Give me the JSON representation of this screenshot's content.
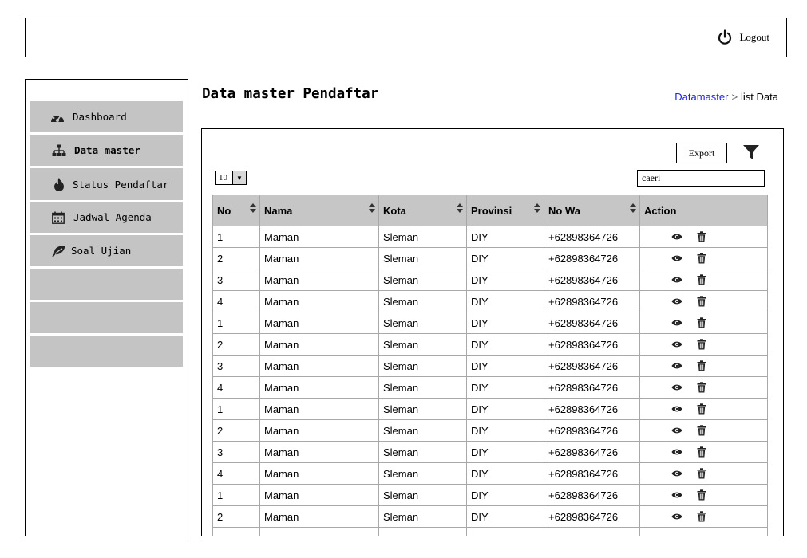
{
  "topbar": {
    "logout_label": "Logout",
    "logout_icon": "power-icon"
  },
  "sidebar": {
    "items": [
      {
        "label": "Dashboard",
        "icon": "dashboard-icon",
        "active": false
      },
      {
        "label": "Data master",
        "icon": "sitemap-icon",
        "active": true
      },
      {
        "label": "Status Pendaftar",
        "icon": "fire-icon",
        "active": false
      },
      {
        "label": "Jadwal Agenda",
        "icon": "calendar-icon",
        "active": false
      },
      {
        "label": "Soal Ujian",
        "icon": "leaf-icon",
        "active": false
      },
      {
        "label": "",
        "icon": "",
        "active": false
      },
      {
        "label": "",
        "icon": "",
        "active": false
      },
      {
        "label": "",
        "icon": "",
        "active": false
      }
    ]
  },
  "main": {
    "title": "Data master Pendaftar",
    "breadcrumb": {
      "link": "Datamaster",
      "separator": ">",
      "current": "list Data"
    }
  },
  "toolbar": {
    "export_label": "Export",
    "filter_icon": "filter-icon",
    "page_size": "10",
    "search_value": "caeri"
  },
  "table": {
    "columns": [
      "No",
      "Nama",
      "Kota",
      "Provinsi",
      "No Wa",
      "Action"
    ],
    "rows": [
      [
        "1",
        "Maman",
        "Sleman",
        "DIY",
        "+62898364726"
      ],
      [
        "2",
        "Maman",
        "Sleman",
        "DIY",
        "+62898364726"
      ],
      [
        "3",
        "Maman",
        "Sleman",
        "DIY",
        "+62898364726"
      ],
      [
        "4",
        "Maman",
        "Sleman",
        "DIY",
        "+62898364726"
      ],
      [
        "1",
        "Maman",
        "Sleman",
        "DIY",
        "+62898364726"
      ],
      [
        "2",
        "Maman",
        "Sleman",
        "DIY",
        "+62898364726"
      ],
      [
        "3",
        "Maman",
        "Sleman",
        "DIY",
        "+62898364726"
      ],
      [
        "4",
        "Maman",
        "Sleman",
        "DIY",
        "+62898364726"
      ],
      [
        "1",
        "Maman",
        "Sleman",
        "DIY",
        "+62898364726"
      ],
      [
        "2",
        "Maman",
        "Sleman",
        "DIY",
        "+62898364726"
      ],
      [
        "3",
        "Maman",
        "Sleman",
        "DIY",
        "+62898364726"
      ],
      [
        "4",
        "Maman",
        "Sleman",
        "DIY",
        "+62898364726"
      ],
      [
        "1",
        "Maman",
        "Sleman",
        "DIY",
        "+62898364726"
      ],
      [
        "2",
        "Maman",
        "Sleman",
        "DIY",
        "+62898364726"
      ],
      [
        "",
        "",
        "",
        "",
        ""
      ]
    ],
    "action_icons": [
      "eye-icon",
      "trash-icon"
    ]
  },
  "colors": {
    "menu_item_bg": "#c4c4c4",
    "header_bg": "#c6c6c6",
    "link": "#2222dd"
  }
}
